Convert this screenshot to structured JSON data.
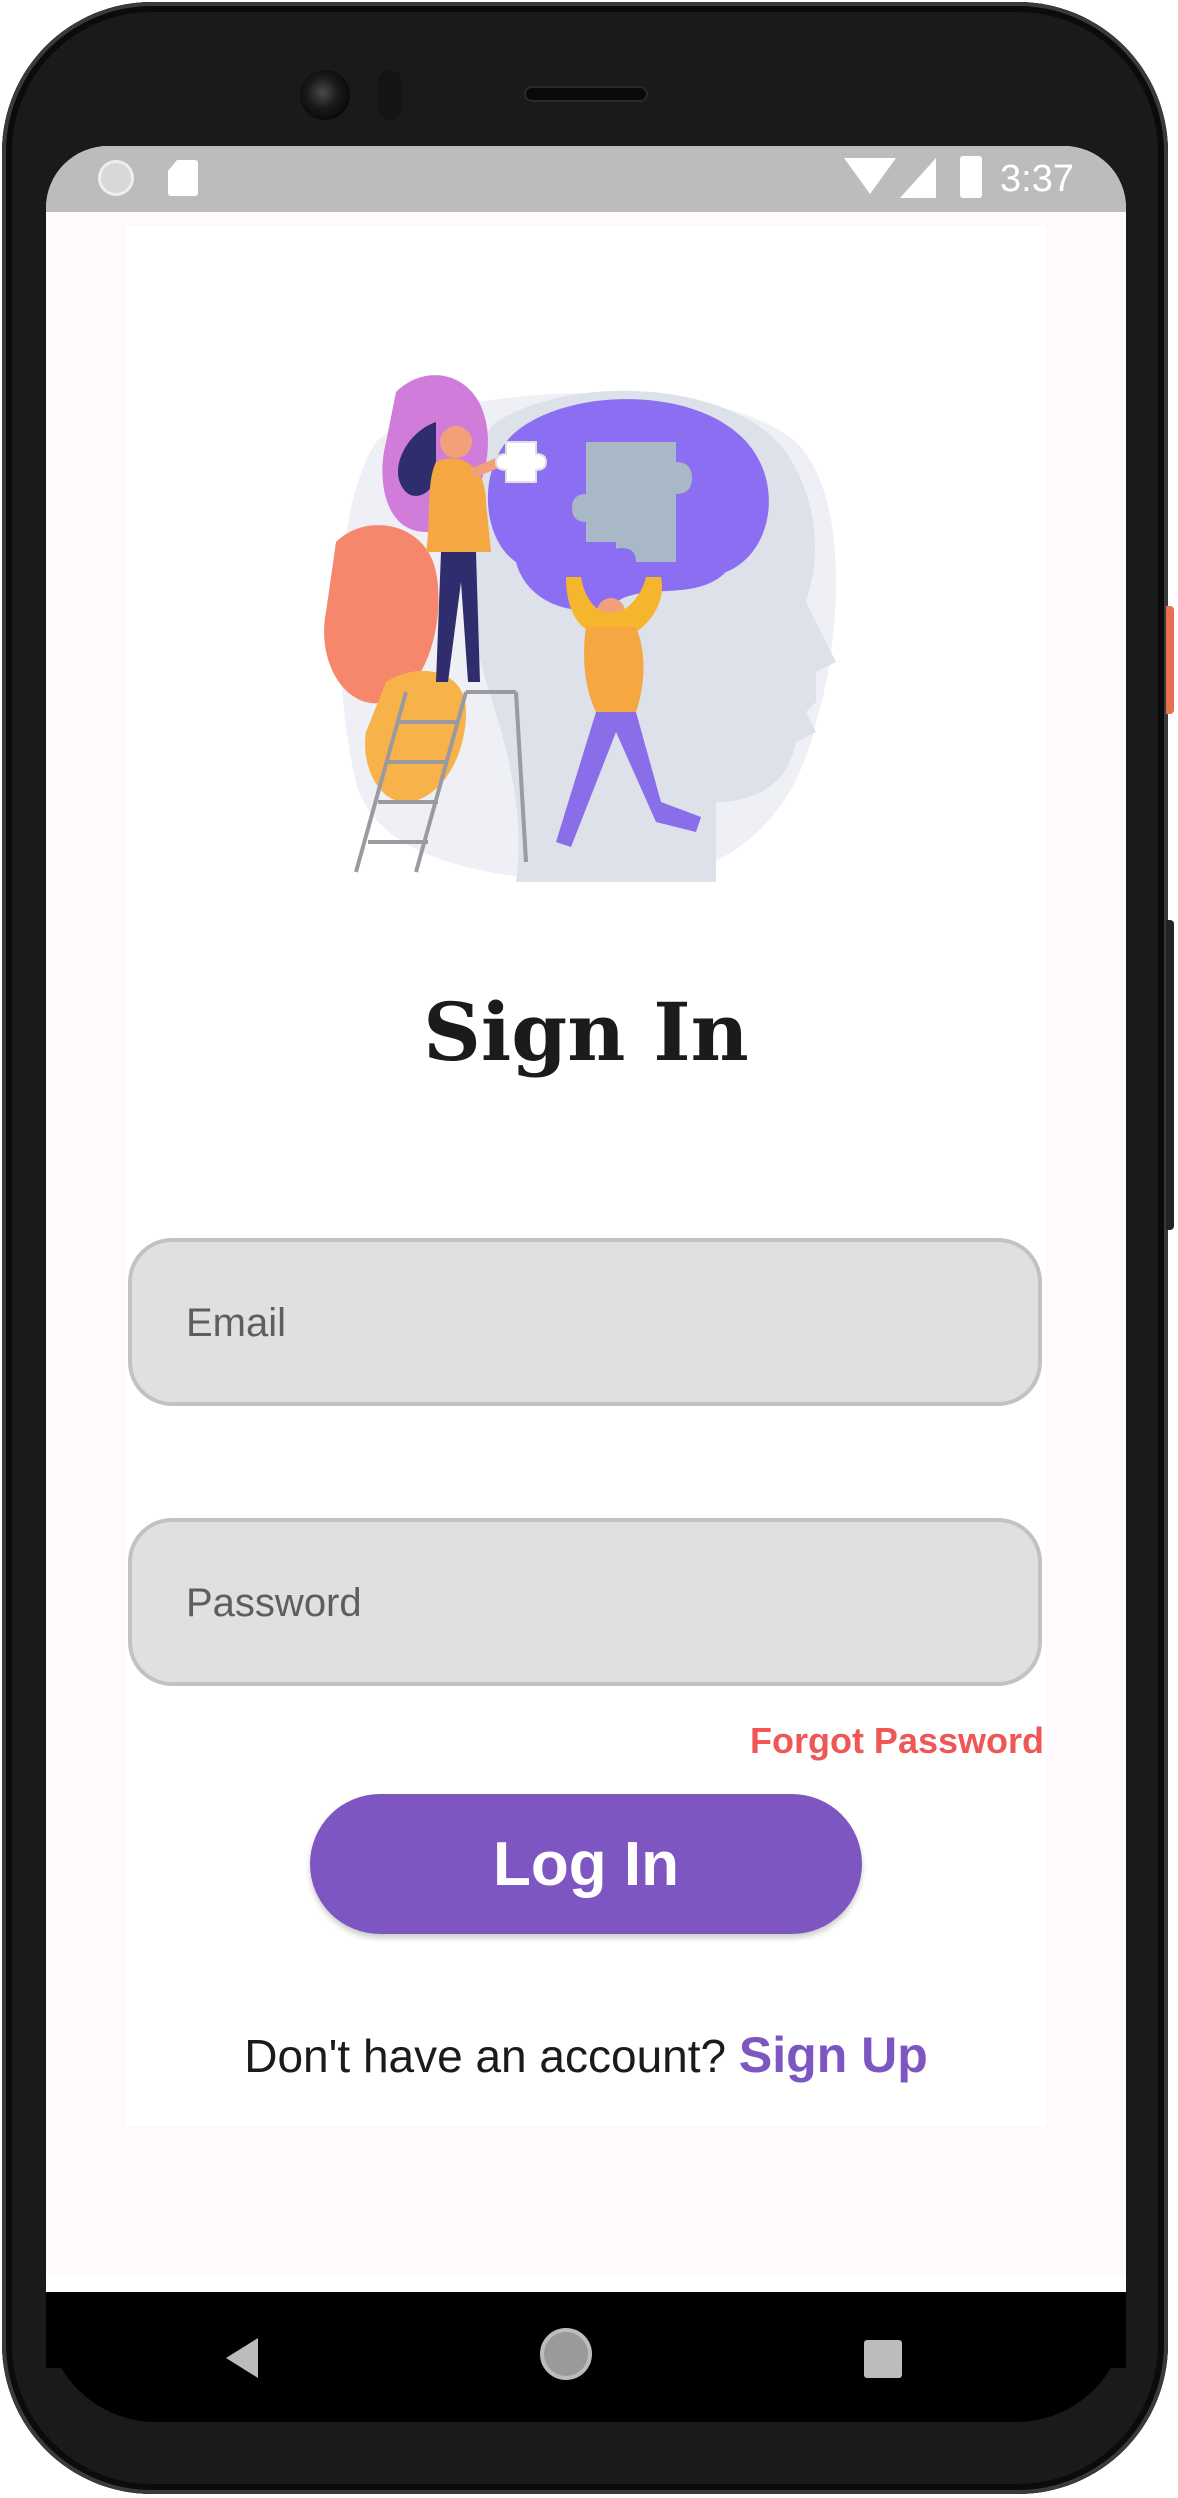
{
  "status_bar": {
    "time": "3:37",
    "icons": [
      "notification-dot-icon",
      "sd-card-icon",
      "wifi-icon",
      "cell-signal-icon",
      "battery-icon"
    ]
  },
  "screen": {
    "title": "Sign In",
    "email": {
      "placeholder": "Email",
      "value": ""
    },
    "password": {
      "placeholder": "Password",
      "value": ""
    },
    "forgot_password_label": "Forgot Password",
    "login_label": "Log In",
    "signup_prompt": "Don't have an account?",
    "signup_link": "Sign Up",
    "illustration": "head-puzzle-illustration"
  },
  "navigation": {
    "icons": [
      "back-icon",
      "home-icon",
      "recents-icon"
    ]
  },
  "colors": {
    "accent": "#7e56c1",
    "forgot_link": "#f05656",
    "field_background": "#e0e0e0",
    "status_bar": "#bdbbbc",
    "app_background": "#fdf9fd"
  }
}
